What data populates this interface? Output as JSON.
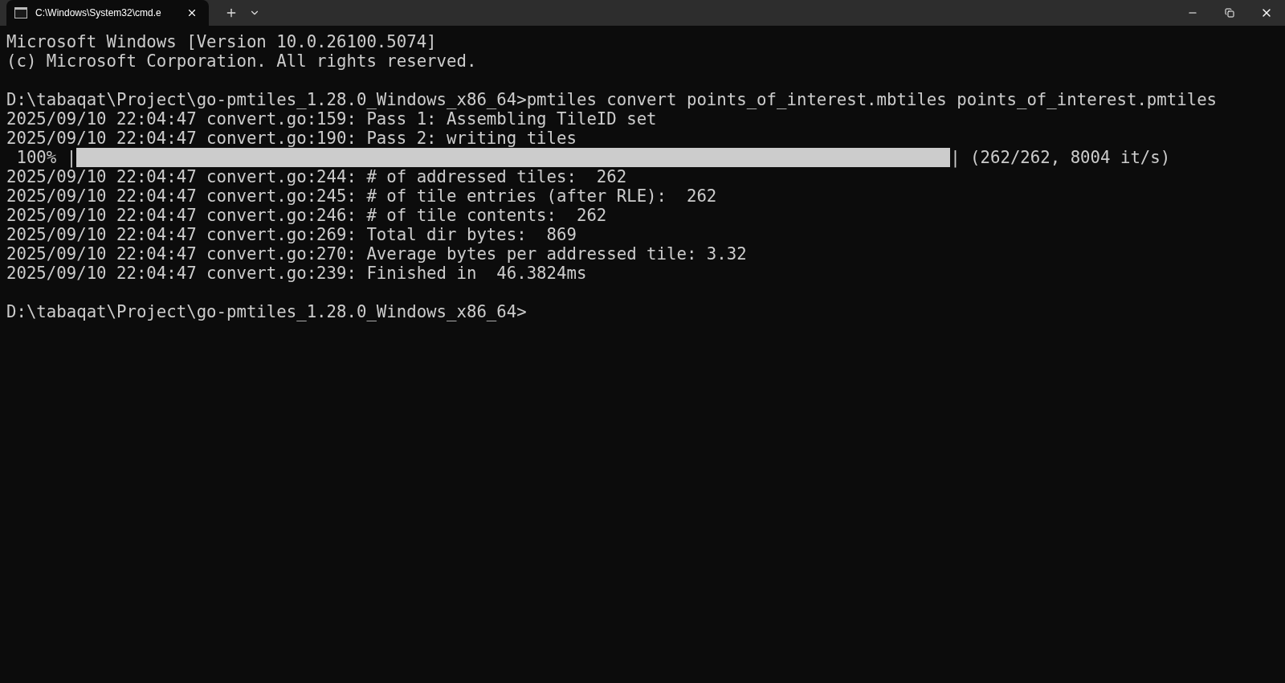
{
  "tab": {
    "title": "C:\\Windows\\System32\\cmd.e",
    "selected": true
  },
  "lines": [
    {
      "kind": "text",
      "text": "Microsoft Windows [Version 10.0.26100.5074]"
    },
    {
      "kind": "text",
      "text": "(c) Microsoft Corporation. All rights reserved."
    },
    {
      "kind": "blank"
    },
    {
      "kind": "text",
      "text": "D:\\tabaqat\\Project\\go-pmtiles_1.28.0_Windows_x86_64>pmtiles convert points_of_interest.mbtiles points_of_interest.pmtiles"
    },
    {
      "kind": "text",
      "text": "2025/09/10 22:04:47 convert.go:159: Pass 1: Assembling TileID set"
    },
    {
      "kind": "text",
      "text": "2025/09/10 22:04:47 convert.go:190: Pass 2: writing tiles"
    },
    {
      "kind": "progress",
      "prefix": " 100% |",
      "suffix": "| (262/262, 8004 it/s)",
      "level": 1
    },
    {
      "kind": "text",
      "text": "2025/09/10 22:04:47 convert.go:244: # of addressed tiles:  262"
    },
    {
      "kind": "text",
      "text": "2025/09/10 22:04:47 convert.go:245: # of tile entries (after RLE):  262"
    },
    {
      "kind": "text",
      "text": "2025/09/10 22:04:47 convert.go:246: # of tile contents:  262"
    },
    {
      "kind": "text",
      "text": "2025/09/10 22:04:47 convert.go:269: Total dir bytes:  869"
    },
    {
      "kind": "text",
      "text": "2025/09/10 22:04:47 convert.go:270: Average bytes per addressed tile: 3.32"
    },
    {
      "kind": "text",
      "text": "2025/09/10 22:04:47 convert.go:239: Finished in  46.3824ms"
    },
    {
      "kind": "blank"
    },
    {
      "kind": "text",
      "text": "D:\\tabaqat\\Project\\go-pmtiles_1.28.0_Windows_x86_64>"
    }
  ]
}
